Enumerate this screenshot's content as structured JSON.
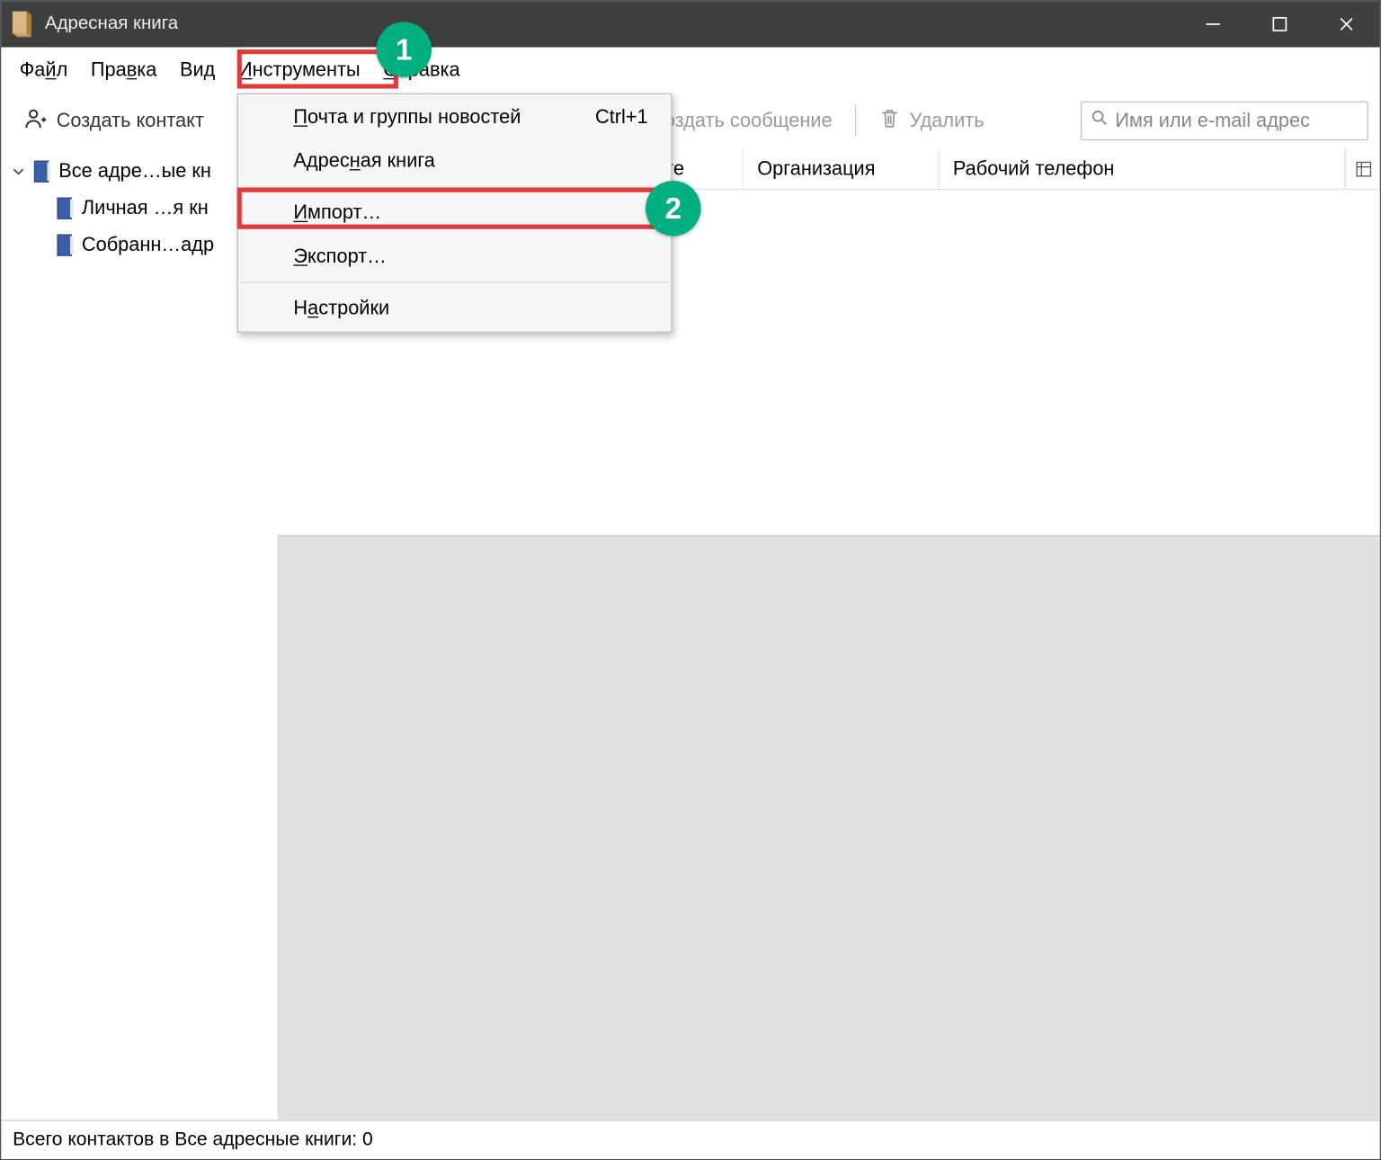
{
  "window": {
    "title": "Адресная книга"
  },
  "menubar": {
    "file": {
      "prefix": "Фа",
      "ul": "й",
      "suffix": "л"
    },
    "edit": {
      "prefix": "Пра",
      "ul": "в",
      "suffix": "ка"
    },
    "view": {
      "prefix": "Ви",
      "ul": "д",
      "suffix": ""
    },
    "tools": {
      "prefix": "",
      "ul": "И",
      "suffix": "нструменты"
    },
    "help": {
      "prefix": "",
      "ul": "С",
      "suffix": "правка"
    }
  },
  "toolbar": {
    "create_contact": "Создать контакт",
    "create_message": "Создать сообщение",
    "delete": "Удалить",
    "search_placeholder": "Имя или e-mail адрес"
  },
  "sidebar": {
    "root": "Все адре…ые кн",
    "child1": "Личная …я кн",
    "child2": "Собранн…адр"
  },
  "columns": {
    "chat_name": "Имя в чате",
    "organization": "Организация",
    "work_phone": "Рабочий телефон"
  },
  "dropdown": {
    "mail_news": {
      "prefix": "",
      "ul": "П",
      "suffix": "очта и группы новостей",
      "shortcut": "Ctrl+1"
    },
    "address_book": {
      "prefix": "Адрес",
      "ul": "н",
      "suffix": "ая книга"
    },
    "import": {
      "prefix": "",
      "ul": "И",
      "suffix": "мпорт…"
    },
    "export": {
      "prefix": "",
      "ul": "Э",
      "suffix": "кспорт…"
    },
    "settings": {
      "prefix": "Н",
      "ul": "а",
      "suffix": "стройки"
    }
  },
  "statusbar": {
    "text": "Всего контактов в Все адресные книги: 0"
  },
  "annotations": {
    "step1": "1",
    "step2": "2"
  }
}
